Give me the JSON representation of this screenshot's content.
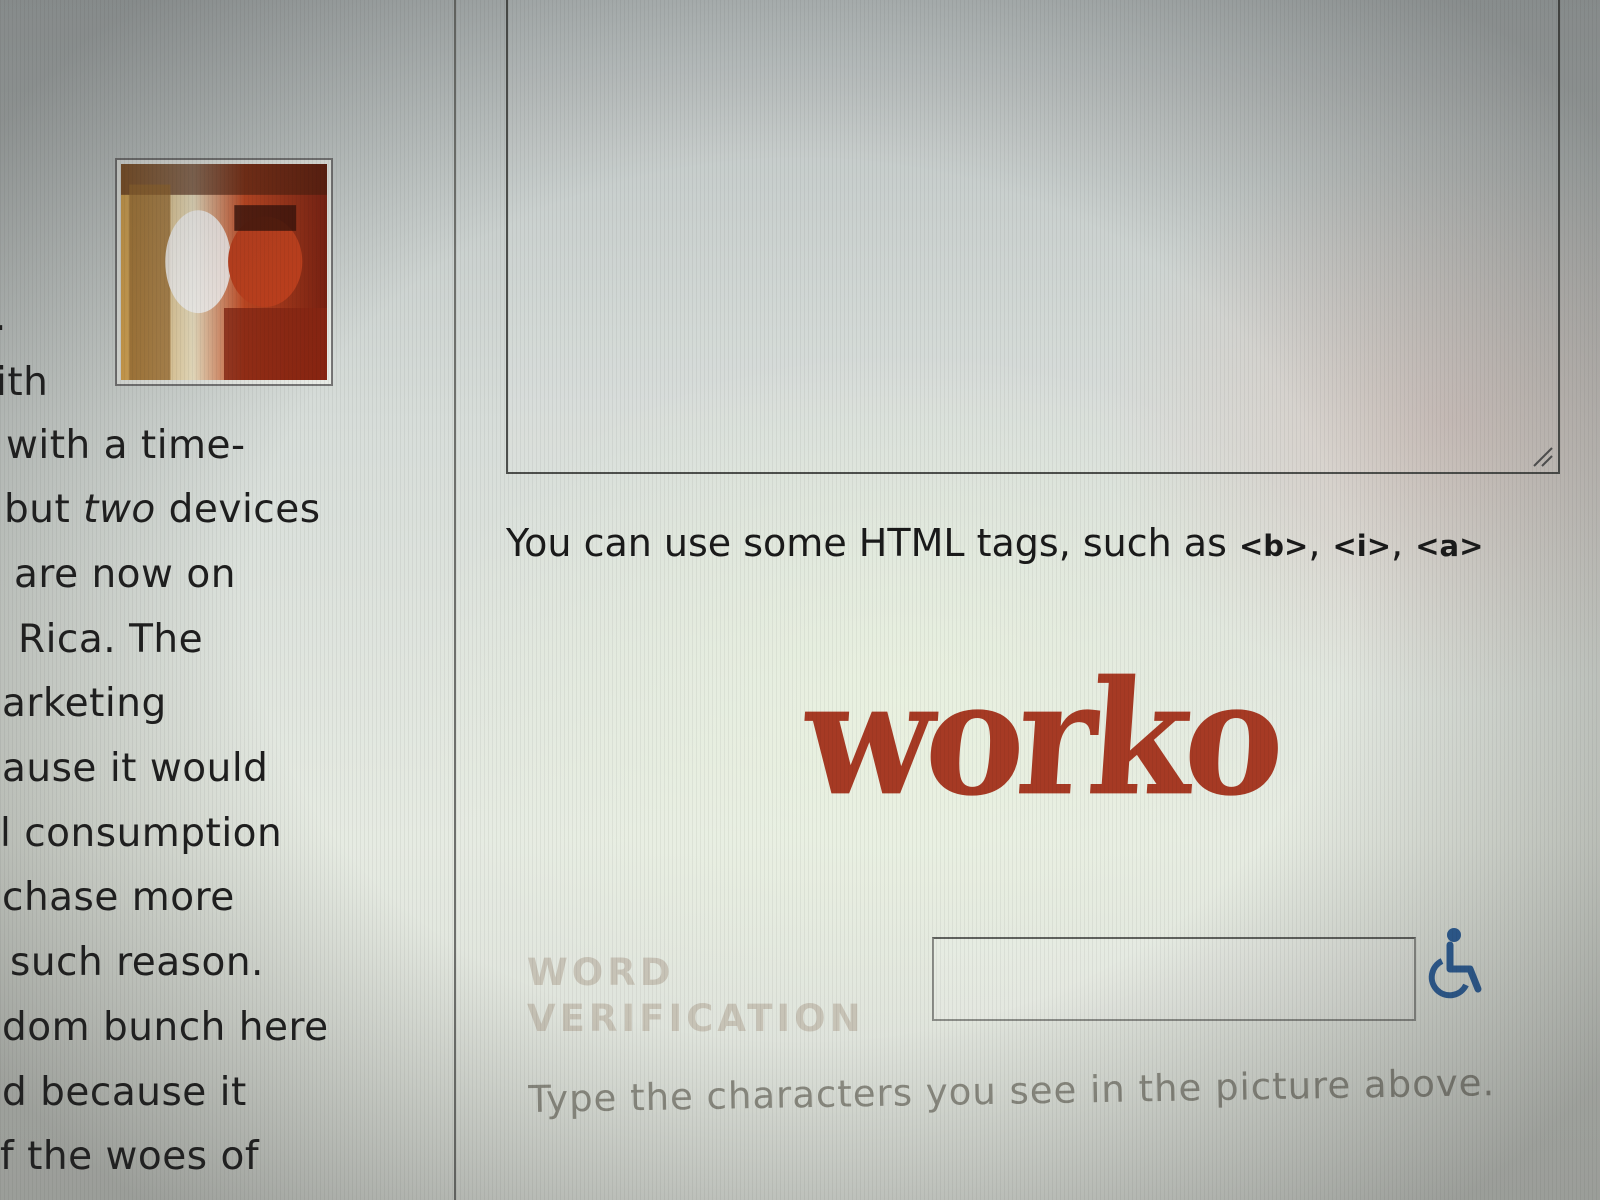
{
  "sidebar": {
    "lines": [
      ".",
      "ith",
      "with a time-",
      "but two devices",
      "are now on",
      "Rica. The",
      "arketing",
      "ause it would",
      "l consumption",
      "chase more",
      "such reason.",
      "dom bunch here",
      "d because it",
      "f the woes of"
    ]
  },
  "comment_form": {
    "html_hint_prefix": "You can use some HTML tags, such as ",
    "tag_b": "<b>",
    "tag_i": "<i>",
    "tag_a": "<a>",
    "separator": ", "
  },
  "verification": {
    "captcha_word": "worko",
    "label_line1": "WORD",
    "label_line2": "VERIFICATION",
    "help_text": "Type the characters you see in the picture above.",
    "input_value": "",
    "captcha_color": "#a63a24",
    "accessibility_icon": "wheelchair-icon",
    "accessibility_color": "#2c5f9a"
  }
}
